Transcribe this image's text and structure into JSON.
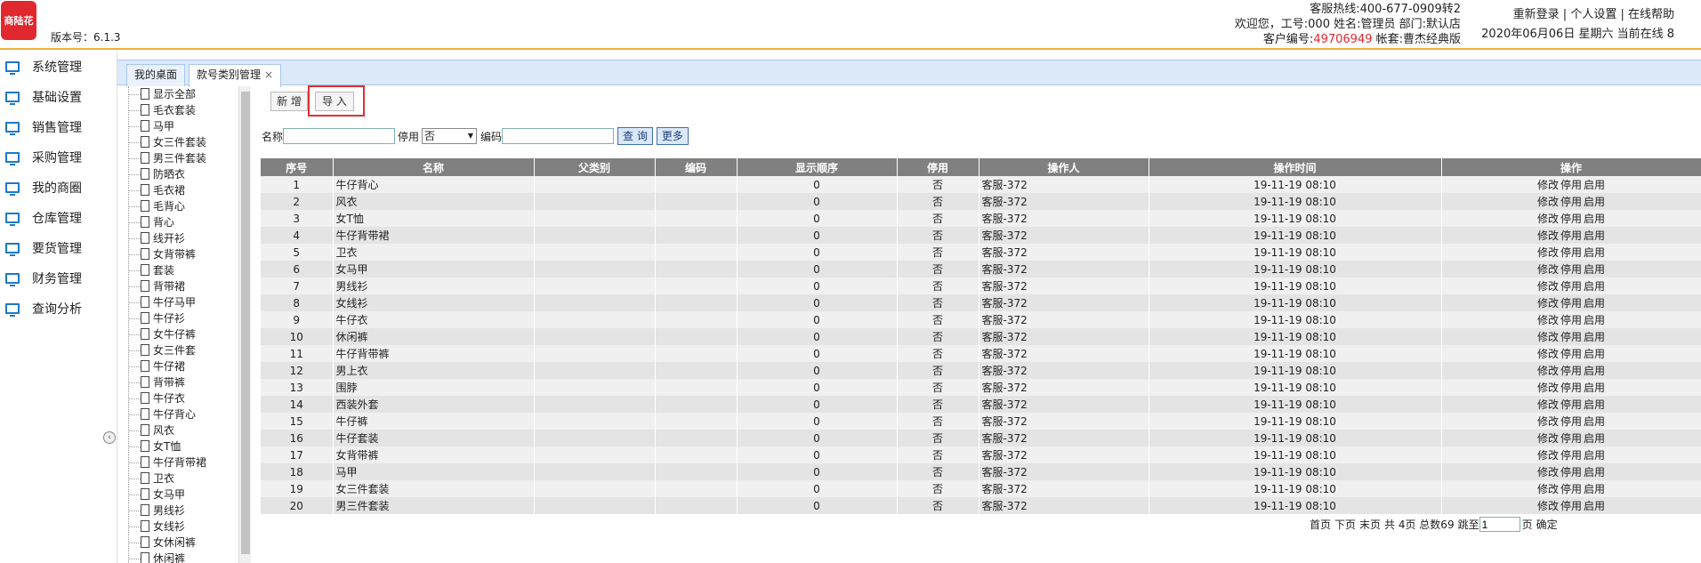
{
  "header": {
    "logo_text": "商陆花",
    "version_label": "版本号：6.1.3",
    "hotline": "客服热线:400-677-0909转2",
    "welcome": "欢迎您，工号:000 姓名:管理员 部门:默认店",
    "customer_no_label": "客户编号:",
    "customer_no": "49706949",
    "account_set": " 帐套:曹杰经典版",
    "relogin": "重新登录",
    "personal_settings": "个人设置",
    "online_help": "在线帮助",
    "separator": " | ",
    "date_line": "2020年06月06日 星期六 当前在线 8"
  },
  "nav": {
    "items": [
      {
        "label": "系统管理"
      },
      {
        "label": "基础设置"
      },
      {
        "label": "销售管理"
      },
      {
        "label": "采购管理"
      },
      {
        "label": "我的商圈"
      },
      {
        "label": "仓库管理"
      },
      {
        "label": "要货管理"
      },
      {
        "label": "财务管理"
      },
      {
        "label": "查询分析"
      }
    ]
  },
  "tabs": {
    "desk": "我的桌面",
    "active": "款号类别管理",
    "close": "×"
  },
  "tree": {
    "items": [
      "显示全部",
      "毛衣套装",
      "马甲",
      "女三件套装",
      "男三件套装",
      "防晒衣",
      "毛衣裙",
      "毛背心",
      "背心",
      "线开衫",
      "女背带裤",
      "套装",
      "背带裙",
      "牛仔马甲",
      "牛仔衫",
      "女牛仔裤",
      "女三件套",
      "牛仔裙",
      "背带裤",
      "牛仔衣",
      "牛仔背心",
      "风衣",
      "女T恤",
      "牛仔背带裙",
      "卫衣",
      "女马甲",
      "男线衫",
      "女线衫",
      "女休闲裤",
      "休闲裤"
    ]
  },
  "toolbar": {
    "new_label": "新 增",
    "import_label": "导 入"
  },
  "search": {
    "name_label": "名称",
    "name_value": "",
    "disabled_label": "停用",
    "disabled_value": "否",
    "code_label": "编码",
    "code_value": "",
    "query_label": "查 询",
    "more_label": "更多"
  },
  "table": {
    "headers": [
      "序号",
      "名称",
      "父类别",
      "编码",
      "显示顺序",
      "停用",
      "操作人",
      "操作时间",
      "操作"
    ],
    "ops": [
      "修改",
      "停用",
      "启用"
    ],
    "rows": [
      {
        "no": "1",
        "name": "牛仔背心",
        "parent": "",
        "code": "",
        "order": "0",
        "disabled": "否",
        "operator": "客服-372",
        "time": "19-11-19 08:10"
      },
      {
        "no": "2",
        "name": "风衣",
        "parent": "",
        "code": "",
        "order": "0",
        "disabled": "否",
        "operator": "客服-372",
        "time": "19-11-19 08:10"
      },
      {
        "no": "3",
        "name": "女T恤",
        "parent": "",
        "code": "",
        "order": "0",
        "disabled": "否",
        "operator": "客服-372",
        "time": "19-11-19 08:10"
      },
      {
        "no": "4",
        "name": "牛仔背带裙",
        "parent": "",
        "code": "",
        "order": "0",
        "disabled": "否",
        "operator": "客服-372",
        "time": "19-11-19 08:10"
      },
      {
        "no": "5",
        "name": "卫衣",
        "parent": "",
        "code": "",
        "order": "0",
        "disabled": "否",
        "operator": "客服-372",
        "time": "19-11-19 08:10"
      },
      {
        "no": "6",
        "name": "女马甲",
        "parent": "",
        "code": "",
        "order": "0",
        "disabled": "否",
        "operator": "客服-372",
        "time": "19-11-19 08:10"
      },
      {
        "no": "7",
        "name": "男线衫",
        "parent": "",
        "code": "",
        "order": "0",
        "disabled": "否",
        "operator": "客服-372",
        "time": "19-11-19 08:10"
      },
      {
        "no": "8",
        "name": "女线衫",
        "parent": "",
        "code": "",
        "order": "0",
        "disabled": "否",
        "operator": "客服-372",
        "time": "19-11-19 08:10"
      },
      {
        "no": "9",
        "name": "牛仔衣",
        "parent": "",
        "code": "",
        "order": "0",
        "disabled": "否",
        "operator": "客服-372",
        "time": "19-11-19 08:10"
      },
      {
        "no": "10",
        "name": "休闲裤",
        "parent": "",
        "code": "",
        "order": "0",
        "disabled": "否",
        "operator": "客服-372",
        "time": "19-11-19 08:10"
      },
      {
        "no": "11",
        "name": "牛仔背带裤",
        "parent": "",
        "code": "",
        "order": "0",
        "disabled": "否",
        "operator": "客服-372",
        "time": "19-11-19 08:10"
      },
      {
        "no": "12",
        "name": "男上衣",
        "parent": "",
        "code": "",
        "order": "0",
        "disabled": "否",
        "operator": "客服-372",
        "time": "19-11-19 08:10"
      },
      {
        "no": "13",
        "name": "围脖",
        "parent": "",
        "code": "",
        "order": "0",
        "disabled": "否",
        "operator": "客服-372",
        "time": "19-11-19 08:10"
      },
      {
        "no": "14",
        "name": "西装外套",
        "parent": "",
        "code": "",
        "order": "0",
        "disabled": "否",
        "operator": "客服-372",
        "time": "19-11-19 08:10"
      },
      {
        "no": "15",
        "name": "牛仔裤",
        "parent": "",
        "code": "",
        "order": "0",
        "disabled": "否",
        "operator": "客服-372",
        "time": "19-11-19 08:10"
      },
      {
        "no": "16",
        "name": "牛仔套装",
        "parent": "",
        "code": "",
        "order": "0",
        "disabled": "否",
        "operator": "客服-372",
        "time": "19-11-19 08:10"
      },
      {
        "no": "17",
        "name": "女背带裤",
        "parent": "",
        "code": "",
        "order": "0",
        "disabled": "否",
        "operator": "客服-372",
        "time": "19-11-19 08:10"
      },
      {
        "no": "18",
        "name": "马甲",
        "parent": "",
        "code": "",
        "order": "0",
        "disabled": "否",
        "operator": "客服-372",
        "time": "19-11-19 08:10"
      },
      {
        "no": "19",
        "name": "女三件套装",
        "parent": "",
        "code": "",
        "order": "0",
        "disabled": "否",
        "operator": "客服-372",
        "time": "19-11-19 08:10"
      },
      {
        "no": "20",
        "name": "男三件套装",
        "parent": "",
        "code": "",
        "order": "0",
        "disabled": "否",
        "operator": "客服-372",
        "time": "19-11-19 08:10"
      }
    ]
  },
  "pager": {
    "first": "首页",
    "next": "下页",
    "last": "末页",
    "summary": "共 4页 总数69",
    "jump_label": "跳至",
    "page_value": "1",
    "page_unit": "页",
    "confirm": "确定"
  },
  "colors": {
    "accent_red": "#e0282e",
    "header_line": "#f0b040",
    "table_header": "#808080",
    "nav_icon": "#1e78c8"
  }
}
